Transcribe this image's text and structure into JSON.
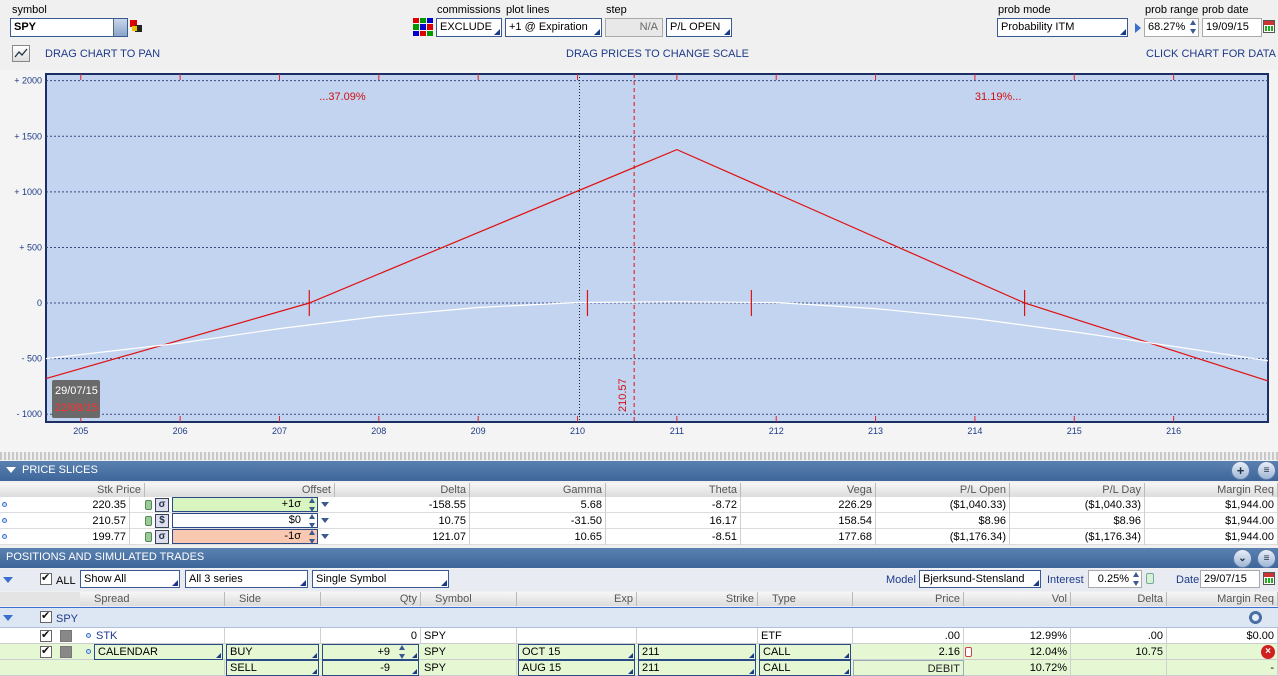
{
  "toolbar": {
    "symbol_label": "symbol",
    "symbol_value": "SPY",
    "commissions_label": "commissions",
    "commissions_value": "EXCLUDE",
    "plot_lines_label": "plot lines",
    "plot_lines_value": "+1 @ Expiration",
    "step_label": "step",
    "step_value": "N/A",
    "pl_mode_value": "P/L OPEN",
    "prob_mode_label": "prob mode",
    "prob_mode_value": "Probability ITM",
    "prob_range_label": "prob range",
    "prob_range_value": "68.27%",
    "prob_date_label": "prob date",
    "prob_date_value": "19/09/15",
    "drag_pan": "DRAG CHART TO PAN",
    "drag_scale": "DRAG PRICES TO CHANGE SCALE",
    "click_data": "CLICK CHART FOR DATA"
  },
  "chart_data": {
    "type": "line",
    "x_ticks": [
      "205",
      "206",
      "207",
      "208",
      "209",
      "210",
      "211",
      "212",
      "213",
      "214",
      "215",
      "216"
    ],
    "y_ticks": [
      "+ 2000",
      "+ 1500",
      "+ 1000",
      "+ 500",
      "0",
      "- 500",
      "- 1000"
    ],
    "xlim": [
      204.65,
      216.95
    ],
    "ylim": [
      -1070,
      2060
    ],
    "left_pct": "...37.09%",
    "right_pct": "31.19%...",
    "current_price_label": "210.57",
    "current_price": 210.57,
    "center_line": 210.02,
    "date_1": "29/07/15",
    "date_2": "22/08/15",
    "series": [
      {
        "color": "#e01010",
        "points": [
          [
            204.65,
            -680
          ],
          [
            207.3,
            0
          ],
          [
            211.0,
            1380
          ],
          [
            214.5,
            0
          ],
          [
            216.95,
            -700
          ]
        ]
      },
      {
        "color": "#ffffff",
        "points": [
          [
            204.65,
            -500
          ],
          [
            206,
            -360
          ],
          [
            207,
            -230
          ],
          [
            208,
            -120
          ],
          [
            209,
            -40
          ],
          [
            210,
            5
          ],
          [
            211,
            10
          ],
          [
            212,
            5
          ],
          [
            213,
            -50
          ],
          [
            214,
            -140
          ],
          [
            215,
            -260
          ],
          [
            216,
            -390
          ],
          [
            216.95,
            -520
          ]
        ]
      }
    ],
    "breakeven_marks": [
      207.3,
      210.1,
      211.75,
      214.5
    ],
    "grid": true
  },
  "price_slices": {
    "title": "PRICE SLICES",
    "columns": [
      "Stk Price",
      "Offset",
      "Delta",
      "Gamma",
      "Theta",
      "Vega",
      "P/L Open",
      "P/L Day",
      "Margin Req"
    ],
    "rows": [
      {
        "stk": "220.35",
        "offset": "+1σ",
        "delta": "-158.55",
        "gamma": "5.68",
        "theta": "-8.72",
        "vega": "226.29",
        "pl_open": "($1,040.33)",
        "pl_day": "($1,040.33)",
        "margin": "$1,944.00"
      },
      {
        "stk": "210.57",
        "offset": "$0",
        "delta": "10.75",
        "gamma": "-31.50",
        "theta": "16.17",
        "vega": "158.54",
        "pl_open": "$8.96",
        "pl_day": "$8.96",
        "margin": "$1,944.00"
      },
      {
        "stk": "199.77",
        "offset": "-1σ",
        "delta": "121.07",
        "gamma": "10.65",
        "theta": "-8.51",
        "vega": "177.68",
        "pl_open": "($1,176.34)",
        "pl_day": "($1,176.34)",
        "margin": "$1,944.00"
      }
    ]
  },
  "positions": {
    "title": "POSITIONS AND SIMULATED TRADES",
    "all_label": "ALL",
    "show_value": "Show All",
    "series_value": "All 3 series",
    "symbol_mode": "Single Symbol",
    "model_label": "Model",
    "model_value": "Bjerksund-Stensland",
    "interest_label": "Interest",
    "interest_value": "0.25%",
    "date_label": "Date",
    "date_value": "29/07/15",
    "columns": [
      "Spread",
      "Side",
      "Qty",
      "Symbol",
      "Exp",
      "Strike",
      "Type",
      "Price",
      "Vol",
      "Delta",
      "Margin Req"
    ],
    "group": "SPY",
    "rows": [
      {
        "spread": "STK",
        "side": "",
        "qty": "0",
        "symbol": "SPY",
        "exp": "",
        "strike": "",
        "type": "ETF",
        "price": ".00",
        "vol": "12.99%",
        "delta": ".00",
        "margin": "$0.00"
      },
      {
        "spread": "CALENDAR",
        "side": "BUY",
        "qty": "+9",
        "symbol": "SPY",
        "exp": "OCT 15",
        "strike": "211",
        "type": "CALL",
        "price": "2.16",
        "vol": "12.04%",
        "delta": "10.75",
        "margin": "-"
      },
      {
        "spread": "",
        "side": "SELL",
        "qty": "-9",
        "symbol": "SPY",
        "exp": "AUG 15",
        "strike": "211",
        "type": "CALL",
        "price": "DEBIT",
        "vol": "10.72%",
        "delta": "",
        "margin": "-"
      }
    ]
  }
}
